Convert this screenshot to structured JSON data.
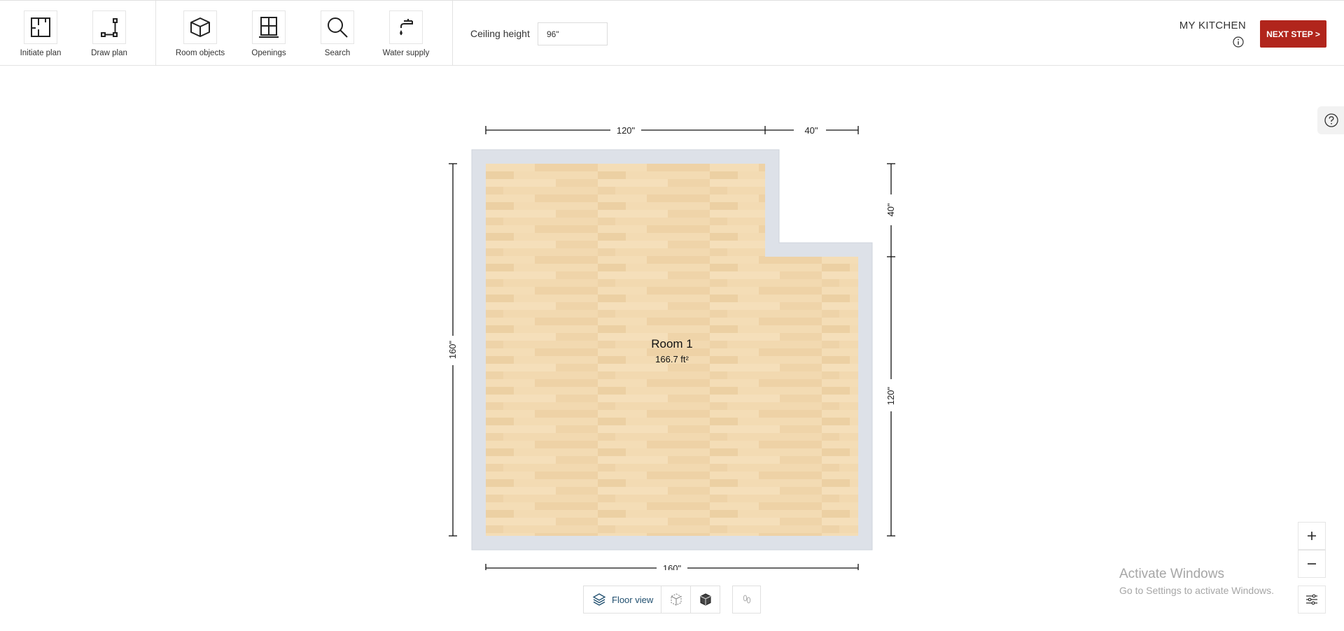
{
  "toolbar": {
    "tools": [
      {
        "label": "Initiate plan",
        "icon": "initiate-plan-icon"
      },
      {
        "label": "Draw plan",
        "icon": "draw-plan-icon"
      },
      {
        "label": "Room objects",
        "icon": "cube-icon"
      },
      {
        "label": "Openings",
        "icon": "window-icon"
      },
      {
        "label": "Search",
        "icon": "search-icon"
      },
      {
        "label": "Water supply",
        "icon": "faucet-icon"
      }
    ],
    "ceiling": {
      "label": "Ceiling height",
      "value": "96\""
    },
    "project_name": "MY KITCHEN",
    "next_step_label": "NEXT STEP >"
  },
  "floor_plan": {
    "room": {
      "name": "Room 1",
      "area": "166.7 ft²"
    },
    "dimensions": {
      "top_left": "120\"",
      "top_right": "40\"",
      "left": "160\"",
      "right_upper": "40\"",
      "right_lower": "120\"",
      "bottom": "160\""
    }
  },
  "view_controls": {
    "floor_view_label": "Floor view"
  },
  "watermark": {
    "title": "Activate Windows",
    "subtitle": "Go to Settings to activate Windows."
  },
  "zoom": {
    "in": "+",
    "out": "−"
  },
  "colors": {
    "accent": "#b1251c",
    "wall": "#dde1e8",
    "floor": "#f1d7ae",
    "view_text": "#1f4e6e"
  }
}
